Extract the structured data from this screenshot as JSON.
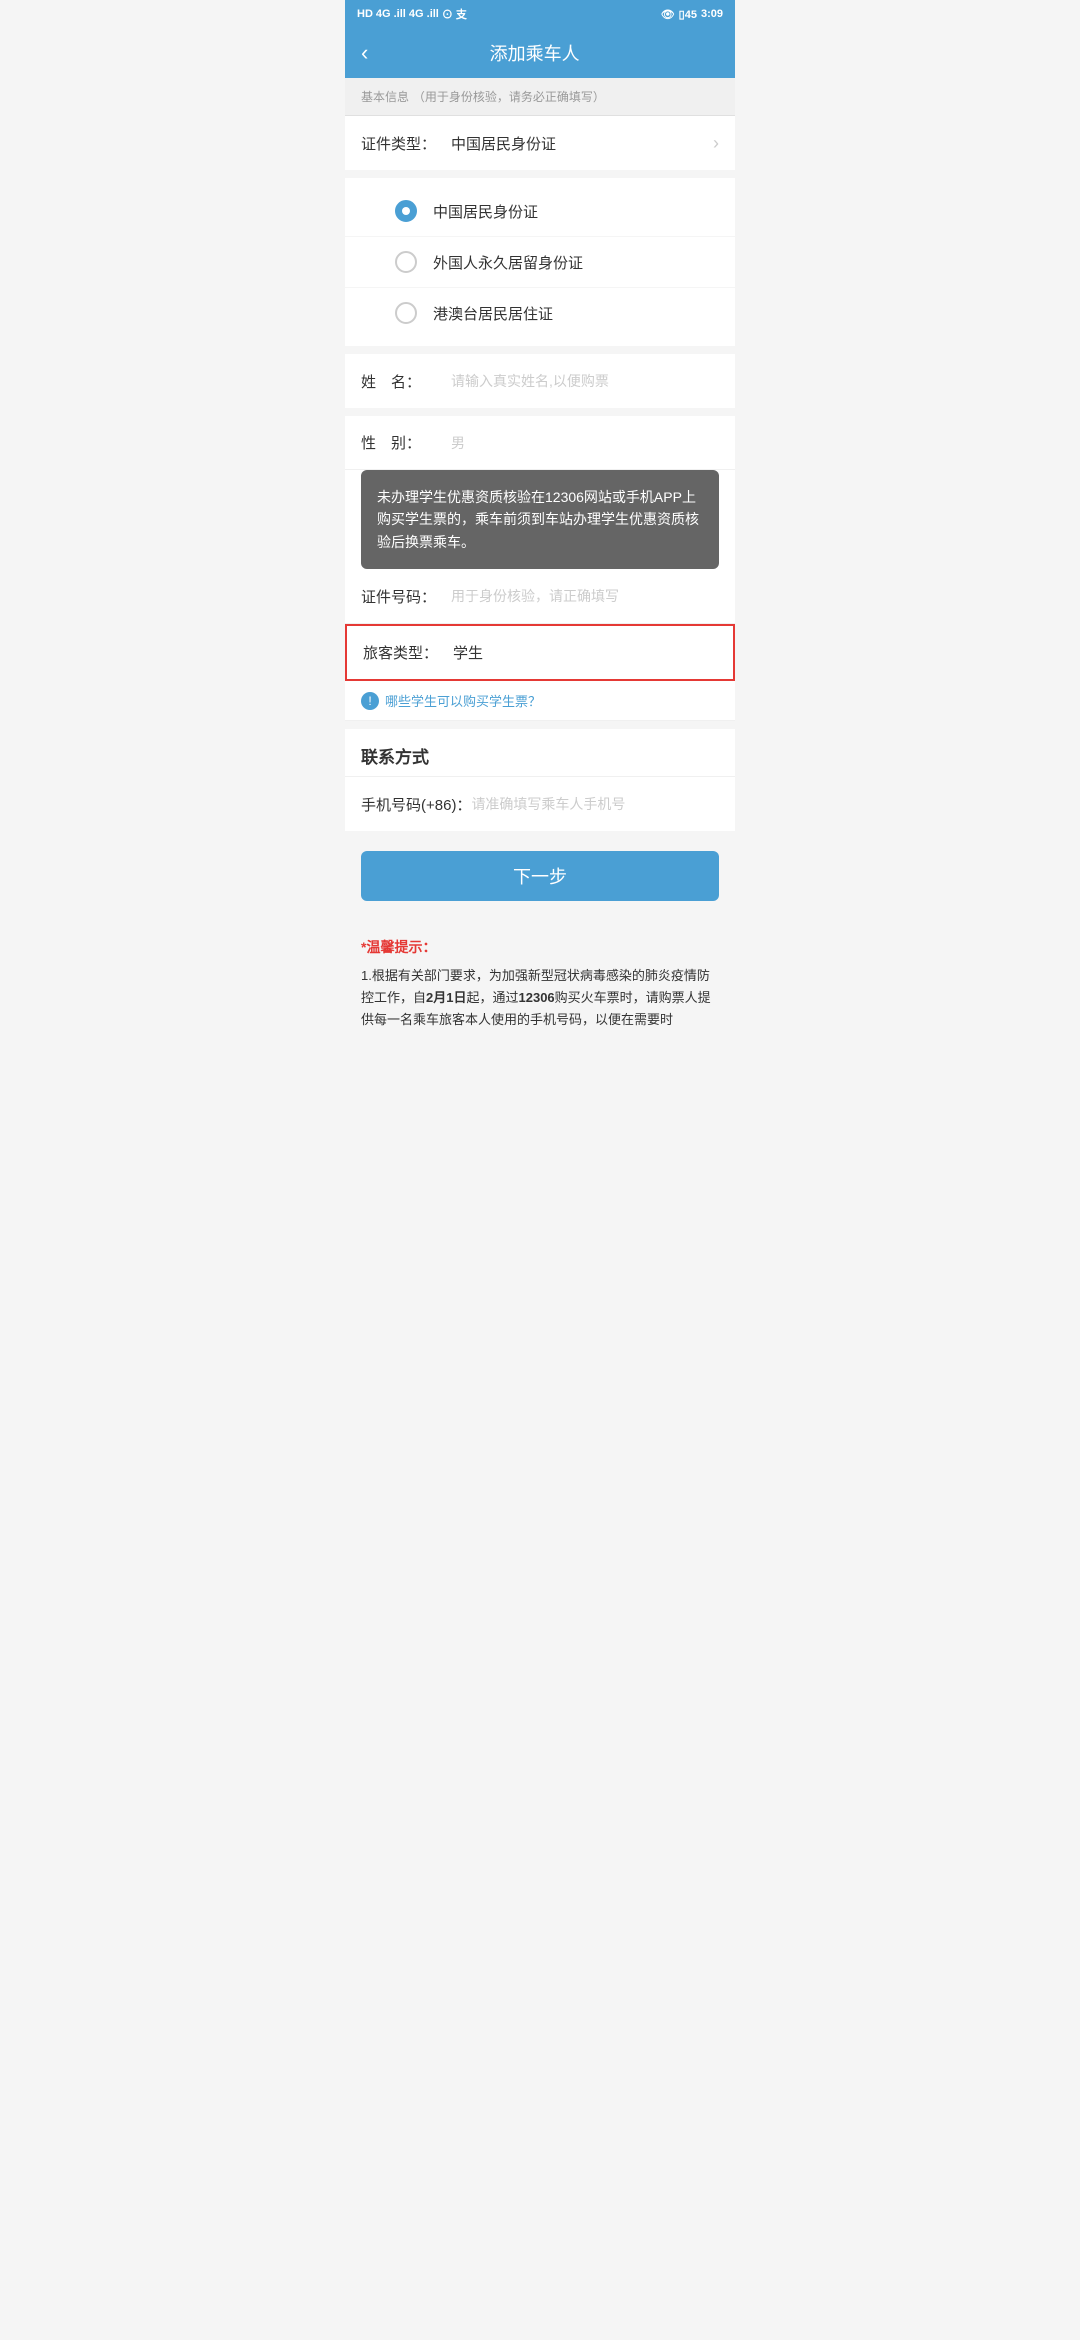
{
  "statusBar": {
    "left": "HD B  4G  .ill  4G .ill  ⓜ  支",
    "right": "👁  □I  45  3:09"
  },
  "header": {
    "backLabel": "‹",
    "title": "添加乘车人"
  },
  "basicInfo": {
    "sectionLabel": "基本信息",
    "sectionNote": "（用于身份核验，请务必正确填写）",
    "idTypeLabel": "证件类型：",
    "idTypeValue": "中国居民身份证",
    "radioOptions": [
      {
        "label": "中国居民身份证",
        "selected": true
      },
      {
        "label": "外国人永久居留身份证",
        "selected": false
      },
      {
        "label": "港澳台居民居住证",
        "selected": false
      }
    ],
    "nameLabel": "姓　名：",
    "namePlaceholder": "请输入真实姓名,以便购票",
    "genderLabel": "性　别：",
    "genderPlaceholder": "男",
    "idNumberLabel": "证件号码：",
    "idNumberPlaceholder": "用于身份核验，请正确填写"
  },
  "tooltip": {
    "text": "未办理学生优惠资质核验在12306网站或手机APP上购买学生票的，乘车前须到车站办理学生优惠资质核验后换票乘车。"
  },
  "passengerType": {
    "label": "旅客类型：",
    "value": "学生"
  },
  "infoLink": {
    "icon": "ℹ",
    "text": "哪些学生可以购买学生票？"
  },
  "contactSection": {
    "title": "联系方式",
    "phoneLabel": "手机号码(+86)：",
    "phonePlaceholder": "请准确填写乘车人手机号"
  },
  "nextButton": {
    "label": "下一步"
  },
  "warmTips": {
    "title": "*温馨提示：",
    "content": "1.根据有关部门要求，为加强新型冠状病毒感染的肺炎疫情防控工作，自2月1日起，通过12306购买火车票时，请购票人提供每一名乘车旅客本人使用的手机号码，以便在需要时"
  }
}
